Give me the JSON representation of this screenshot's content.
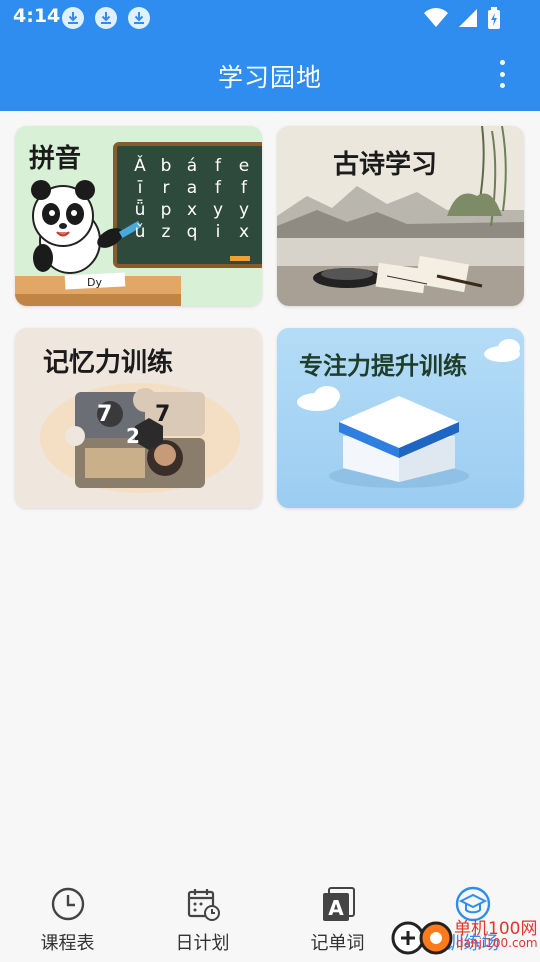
{
  "status_bar": {
    "time": "4:14"
  },
  "app_bar": {
    "title": "学习园地"
  },
  "cards": [
    {
      "title": "拼音",
      "board_letters": [
        "Ǎ",
        "b",
        "á",
        "f",
        "e",
        "ī",
        "r",
        "a",
        "f",
        "f",
        "ǖ",
        "p",
        "x",
        "y",
        "y",
        "ǔ",
        "z",
        "q",
        "i",
        "x"
      ],
      "paper_text": "Dy"
    },
    {
      "title": "古诗学习"
    },
    {
      "title": "记忆力训练",
      "puzzle_numbers": [
        "7",
        "2",
        "7"
      ]
    },
    {
      "title": "专注力提升训练"
    }
  ],
  "bottom_nav": [
    {
      "label": "课程表",
      "icon": "clock-icon"
    },
    {
      "label": "日计划",
      "icon": "calendar-icon"
    },
    {
      "label": "记单词",
      "icon": "letter-a-icon"
    },
    {
      "label": "训练场",
      "icon": "graduation-cap-icon"
    }
  ],
  "watermark": {
    "text1": "单机100网",
    "text2": "danji100.com"
  },
  "colors": {
    "primary": "#2f8df0",
    "background": "#f7f7f7"
  }
}
